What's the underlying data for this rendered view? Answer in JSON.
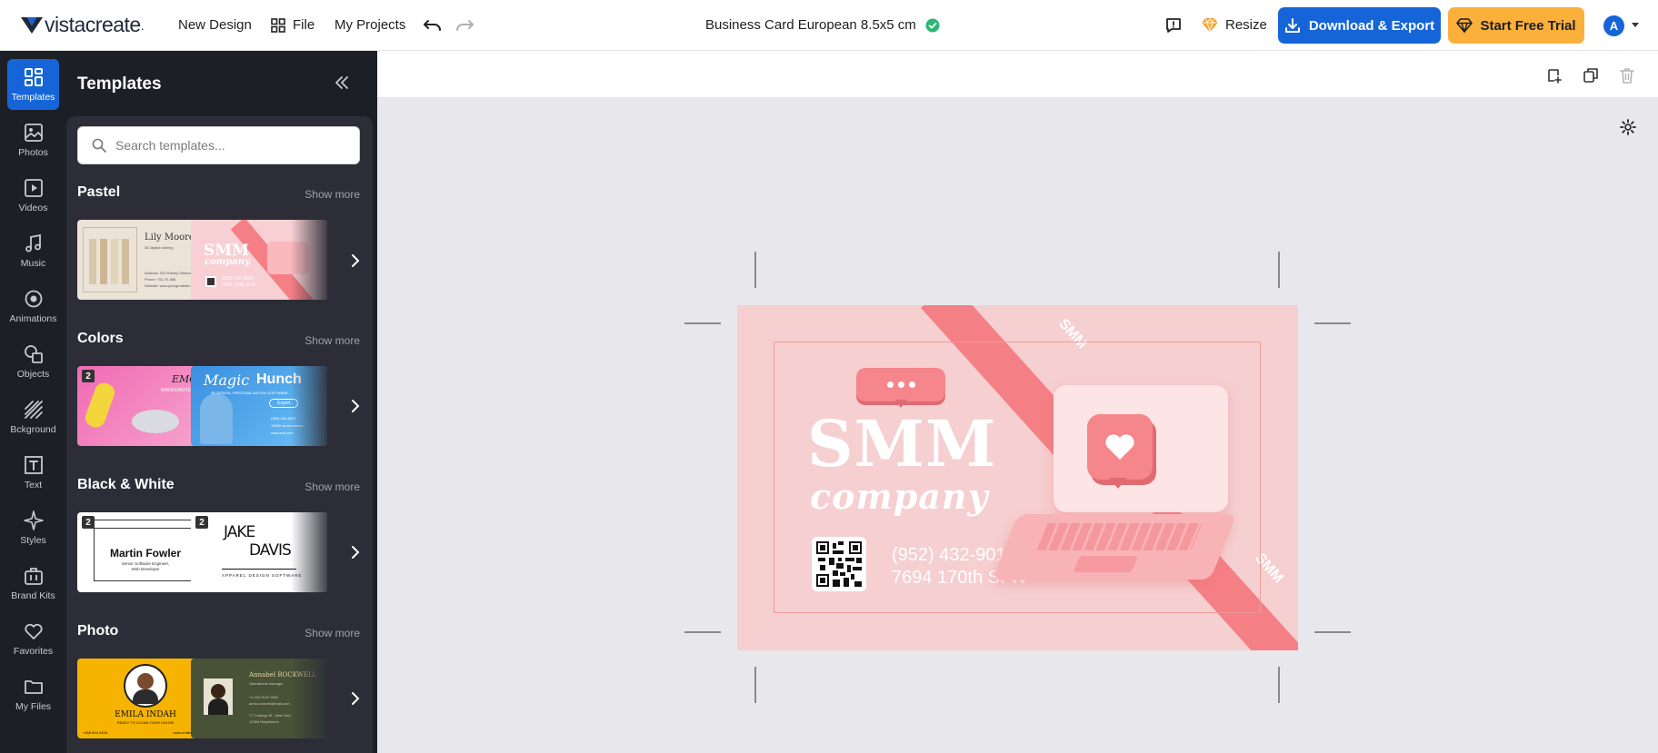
{
  "topbar": {
    "logo_text": "vistacreate",
    "new_design": "New Design",
    "file": "File",
    "my_projects": "My Projects",
    "doc_title": "Business Card European 8.5x5 cm",
    "resize": "Resize",
    "download_export": "Download & Export",
    "start_free_trial": "Start Free Trial",
    "avatar_initial": "A"
  },
  "rail": {
    "items": [
      {
        "label": "Templates",
        "icon": "templates-icon",
        "active": true
      },
      {
        "label": "Photos",
        "icon": "photos-icon"
      },
      {
        "label": "Videos",
        "icon": "videos-icon"
      },
      {
        "label": "Music",
        "icon": "music-icon"
      },
      {
        "label": "Animations",
        "icon": "animations-icon"
      },
      {
        "label": "Objects",
        "icon": "objects-icon"
      },
      {
        "label": "Bckground",
        "icon": "background-icon"
      },
      {
        "label": "Text",
        "icon": "text-icon"
      },
      {
        "label": "Styles",
        "icon": "styles-icon"
      },
      {
        "label": "Brand Kits",
        "icon": "brand-kits-icon"
      },
      {
        "label": "Favorites",
        "icon": "favorites-icon"
      },
      {
        "label": "My Files",
        "icon": "my-files-icon"
      }
    ]
  },
  "panel": {
    "title": "Templates",
    "search_placeholder": "Search templates...",
    "sections": [
      {
        "title": "Pastel",
        "more": "Show more",
        "thumbs": [
          {
            "lines": [
              "Lily Moore",
              "3D digital clothing",
              "Address: 322 Rainey Silhone, Italy",
              "Phone: 752-70-366",
              "Website: www.yourgreatsite.com"
            ]
          },
          {
            "lines": [
              "SMM",
              "company",
              "(952) 432-9014",
              "7694 170th St W"
            ]
          }
        ]
      },
      {
        "title": "Colors",
        "more": "Show more",
        "thumbs": [
          {
            "badge": "2",
            "lines": [
              "EMOTE",
              "WWW.EMOTE.COM"
            ]
          },
          {
            "lines": [
              "Magic",
              "Hunch",
              "3D DESIGN, PERSONALIZATION SOFTWARE",
              "Expert",
              "(263) 354-8879",
              "79000 street adress",
              "www.eml.com"
            ]
          }
        ]
      },
      {
        "title": "Black & White",
        "more": "Show more",
        "thumbs": [
          {
            "badge": "2",
            "lines": [
              "Martin Fowler",
              "Senior Software Engineer,",
              "Web Developer"
            ]
          },
          {
            "badge": "2",
            "lines": [
              "JAKE",
              "DAVIS",
              "APPAREL DESIGN SOFTWARE"
            ]
          }
        ]
      },
      {
        "title": "Photo",
        "more": "Show more",
        "thumbs": [
          {
            "lines": [
              "EMILA INDAH",
              "READY TO CLEAN YOUR HOUSE",
              "+458 894 3406",
              "www.emiliaindah.com"
            ]
          },
          {
            "lines": [
              "Annabel ROCKWELL",
              "Operational manager",
              "+1 220 9122 9902",
              "anna.rockwell@mail.com",
              "77 Curtings St., New York,",
              "12354 Neighbours"
            ]
          }
        ]
      }
    ]
  },
  "card": {
    "band_text_top": "SMM",
    "band_text_bottom": "SMM",
    "headline": "SMM",
    "subheadline": "company",
    "phone": "(952) 432-9014",
    "address": "7694 170th St W"
  },
  "colors": {
    "primary": "#1565d8",
    "trial": "#fbb03b",
    "card_bg": "#f6cfd0",
    "card_accent": "#f47f84",
    "panel_bg": "#1d1f27"
  }
}
